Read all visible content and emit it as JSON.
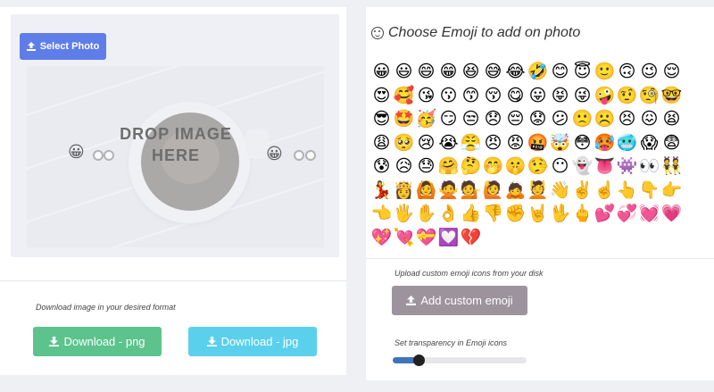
{
  "left": {
    "select_label": "Select Photo",
    "drop_text": "DROP IMAGE\nHERE",
    "download_hint": "Download image in your desired format",
    "png_label": "Download - png",
    "jpg_label": "Download - jpg"
  },
  "right": {
    "title": "Choose Emoji to add on photo",
    "emojis": [
      "😀",
      "😃",
      "😄",
      "😁",
      "😆",
      "😅",
      "😂",
      "🤣",
      "😊",
      "😇",
      "🙂",
      "🙃",
      "😉",
      "😌",
      "😍",
      "🥰",
      "😘",
      "😗",
      "😙",
      "😚",
      "😋",
      "😛",
      "😝",
      "😜",
      "🤪",
      "🤨",
      "🧐",
      "🤓",
      "😎",
      "🤩",
      "🥳",
      "😏",
      "😒",
      "😞",
      "😔",
      "😟",
      "😕",
      "🙁",
      "☹️",
      "😣",
      "😖",
      "😫",
      "😩",
      "🥺",
      "😢",
      "😭",
      "😤",
      "😠",
      "😡",
      "🤬",
      "🤯",
      "😳",
      "🥵",
      "🥶",
      "😱",
      "😨",
      "😰",
      "😥",
      "😓",
      "🤗",
      "🤔",
      "🤭",
      "🤫",
      "🤥",
      "😶",
      "👻",
      "👅",
      "👾",
      "👀",
      "👯",
      "💃",
      "👸",
      "🙆",
      "🙅",
      "💁",
      "🙋",
      "🙇",
      "💆",
      "👋",
      "✌️",
      "☝️",
      "👆",
      "👇",
      "👉",
      "👈",
      "🖐️",
      "✋",
      "👌",
      "👍",
      "👎",
      "✊",
      "🤘",
      "🖖",
      "🖕",
      "💕",
      "💞",
      "💓",
      "💗",
      "💖",
      "💘",
      "💝",
      "💟",
      "💔"
    ],
    "custom_hint": "Upload custom emoji icons from your disk",
    "custom_label": "Add custom emoji",
    "transparency_label": "Set transparency in Emoji icons",
    "transparency_value": 0.19
  },
  "colors": {
    "select": "#5f7de9",
    "png": "#5cc38d",
    "jpg": "#5ad0ec",
    "custom": "#9d939d",
    "slider": "#3f74b8"
  },
  "icons": {
    "upload": "upload-icon",
    "download": "download-icon",
    "smile": "smile-icon"
  }
}
